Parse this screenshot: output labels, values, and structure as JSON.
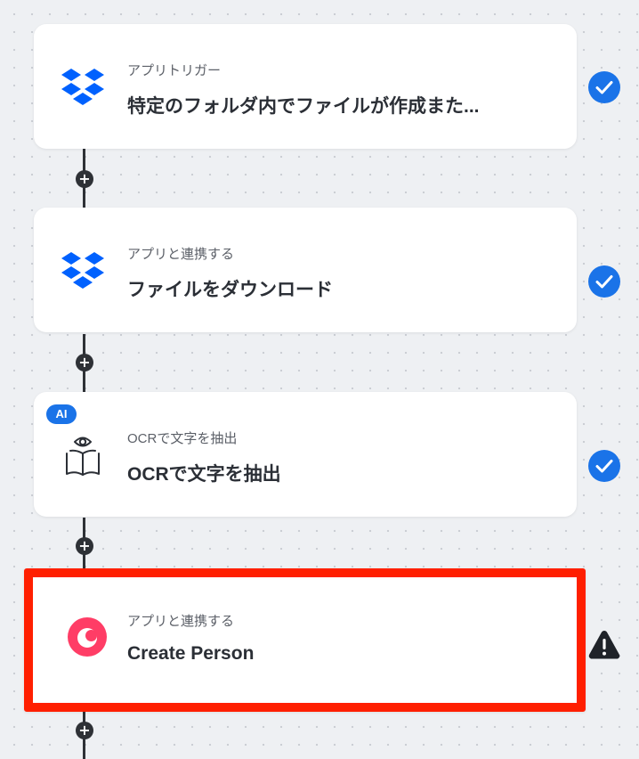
{
  "flow": {
    "steps": [
      {
        "subtitle": "アプリトリガー",
        "title": "特定のフォルダ内でファイルが作成また...",
        "icon": "dropbox-icon",
        "status": "complete"
      },
      {
        "subtitle": "アプリと連携する",
        "title": "ファイルをダウンロード",
        "icon": "dropbox-icon",
        "status": "complete"
      },
      {
        "subtitle": "OCRで文字を抽出",
        "title": "OCRで文字を抽出",
        "icon": "ocr-book-eye-icon",
        "badge": "AI",
        "status": "complete"
      },
      {
        "subtitle": "アプリと連携する",
        "title": "Create Person",
        "icon": "capsule-crm-icon",
        "status": "warning",
        "selected": true
      }
    ],
    "add_button_glyph": "+"
  },
  "colors": {
    "complete": "#1a73e8",
    "warning": "#1f2329",
    "selection_border": "#ff1f00",
    "dropbox": "#0061fe",
    "capsule": "#ff3d66"
  }
}
